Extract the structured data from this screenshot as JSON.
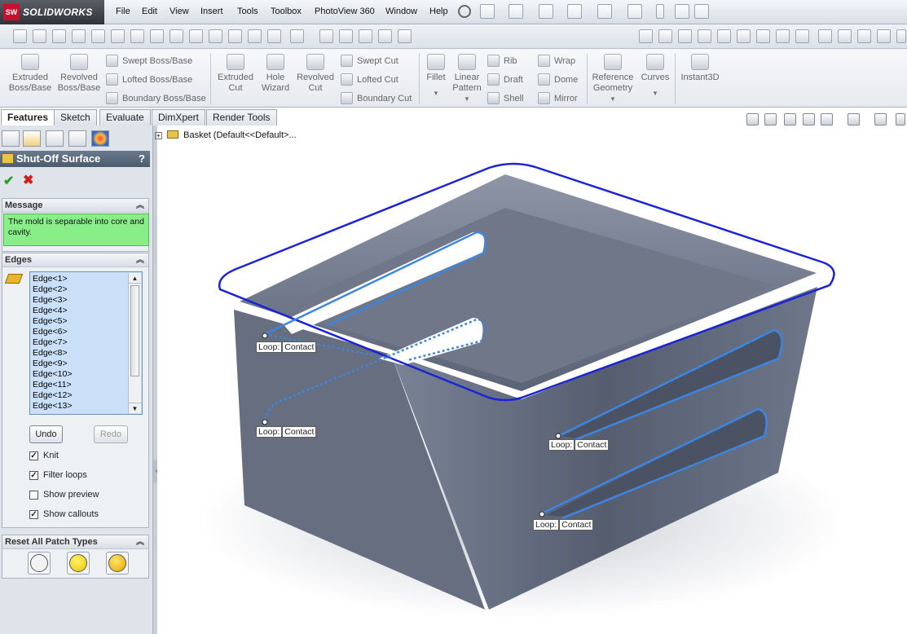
{
  "app": {
    "logo_badge": "SW",
    "logo_text": "SOLIDWORKS"
  },
  "menu": [
    "File",
    "Edit",
    "View",
    "Insert",
    "Tools",
    "Toolbox",
    "PhotoView 360",
    "Window",
    "Help"
  ],
  "features_ribbon": {
    "extruded_boss": "Extruded Boss/Base",
    "revolved_boss": "Revolved Boss/Base",
    "swept_boss": "Swept Boss/Base",
    "lofted_boss": "Lofted Boss/Base",
    "boundary_boss": "Boundary Boss/Base",
    "extruded_cut": "Extruded Cut",
    "hole_wizard": "Hole Wizard",
    "revolved_cut": "Revolved Cut",
    "swept_cut": "Swept Cut",
    "lofted_cut": "Lofted Cut",
    "boundary_cut": "Boundary Cut",
    "fillet": "Fillet",
    "linear_pattern": "Linear Pattern",
    "rib": "Rib",
    "draft": "Draft",
    "shell": "Shell",
    "wrap": "Wrap",
    "dome": "Dome",
    "mirror": "Mirror",
    "reference_geometry": "Reference Geometry",
    "curves": "Curves",
    "instant3d": "Instant3D"
  },
  "tabs": [
    "Features",
    "Sketch",
    "Evaluate",
    "DimXpert",
    "Render Tools"
  ],
  "property_manager": {
    "title": "Shut-Off Surface",
    "help": "?",
    "message_header": "Message",
    "message": "The mold is separable into core and cavity.",
    "edges_header": "Edges",
    "edges": [
      "Edge<1>",
      "Edge<2>",
      "Edge<3>",
      "Edge<4>",
      "Edge<5>",
      "Edge<6>",
      "Edge<7>",
      "Edge<8>",
      "Edge<9>",
      "Edge<10>",
      "Edge<11>",
      "Edge<12>",
      "Edge<13>"
    ],
    "undo": "Undo",
    "redo": "Redo",
    "options": [
      {
        "label": "Knit",
        "checked": true
      },
      {
        "label": "Filter loops",
        "checked": true
      },
      {
        "label": "Show preview",
        "checked": false
      },
      {
        "label": "Show callouts",
        "checked": true
      }
    ],
    "reset_header": "Reset All Patch Types"
  },
  "feature_tree": {
    "root": "Basket  (Default<<Default>..."
  },
  "callouts": [
    {
      "loop": "Loop:",
      "type": "Contact"
    },
    {
      "loop": "Loop:",
      "type": "Contact"
    },
    {
      "loop": "Loop:",
      "type": "Contact"
    },
    {
      "loop": "Loop:",
      "type": "Contact"
    }
  ],
  "colors": {
    "accent": "#3d86e0",
    "highlight_edge": "#1a23d6",
    "message_bg": "#88ef88",
    "part_body": "#6b7487"
  }
}
